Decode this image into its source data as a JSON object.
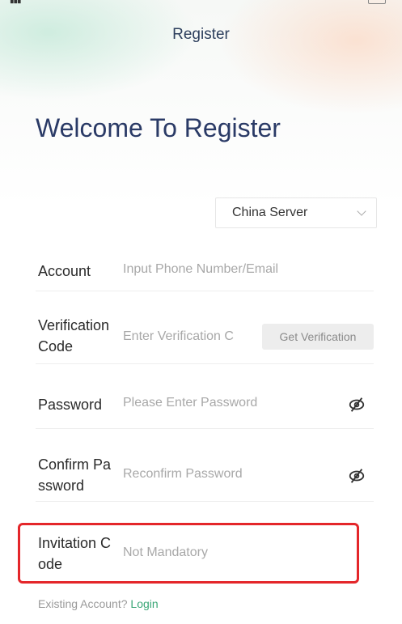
{
  "header": {
    "title": "Register"
  },
  "welcome": "Welcome To Register",
  "server": {
    "selected": "China Server"
  },
  "form": {
    "account": {
      "label": "Account",
      "placeholder": "Input Phone Number/Email"
    },
    "verification": {
      "label_line1": "Verification",
      "label_line2": "Code",
      "placeholder": "Enter Verification C",
      "button": "Get Verification"
    },
    "password": {
      "label": "Password",
      "placeholder": "Please Enter Password"
    },
    "confirm": {
      "label_line1": "Confirm Pa",
      "label_line2": "ssword",
      "placeholder": "Reconfirm Password"
    },
    "invitation": {
      "label_line1": "Invitation C",
      "label_line2": "ode",
      "placeholder": "Not Mandatory"
    }
  },
  "footer": {
    "text": "Existing Account?",
    "login": "Login"
  },
  "colors": {
    "accent": "#3aa676",
    "title": "#2a3a66",
    "highlight": "#e4262a"
  },
  "icons": {
    "password_toggle": "eye-slash-icon",
    "select": "chevron-down-icon"
  }
}
